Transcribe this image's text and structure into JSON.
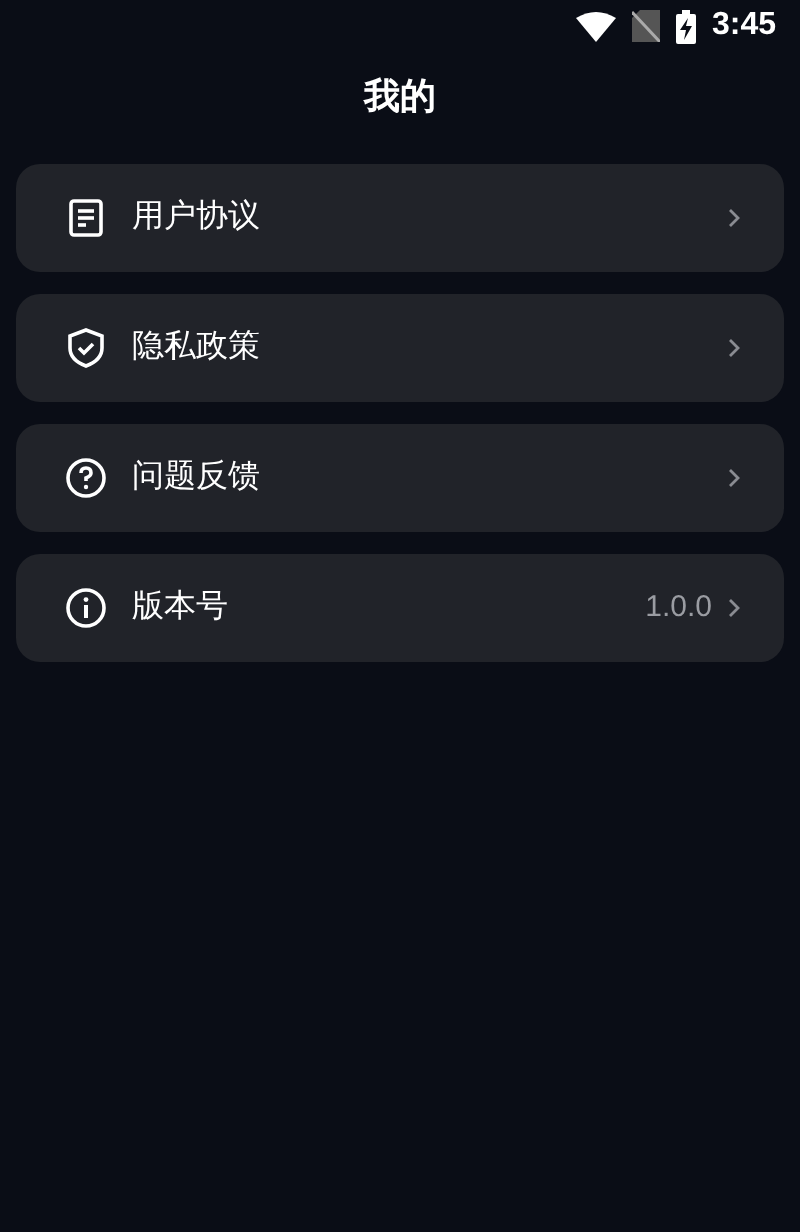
{
  "status_bar": {
    "time": "3:45"
  },
  "header": {
    "title": "我的"
  },
  "menu": [
    {
      "label": "用户协议"
    },
    {
      "label": "隐私政策"
    },
    {
      "label": "问题反馈"
    },
    {
      "label": "版本号",
      "value": "1.0.0"
    }
  ]
}
